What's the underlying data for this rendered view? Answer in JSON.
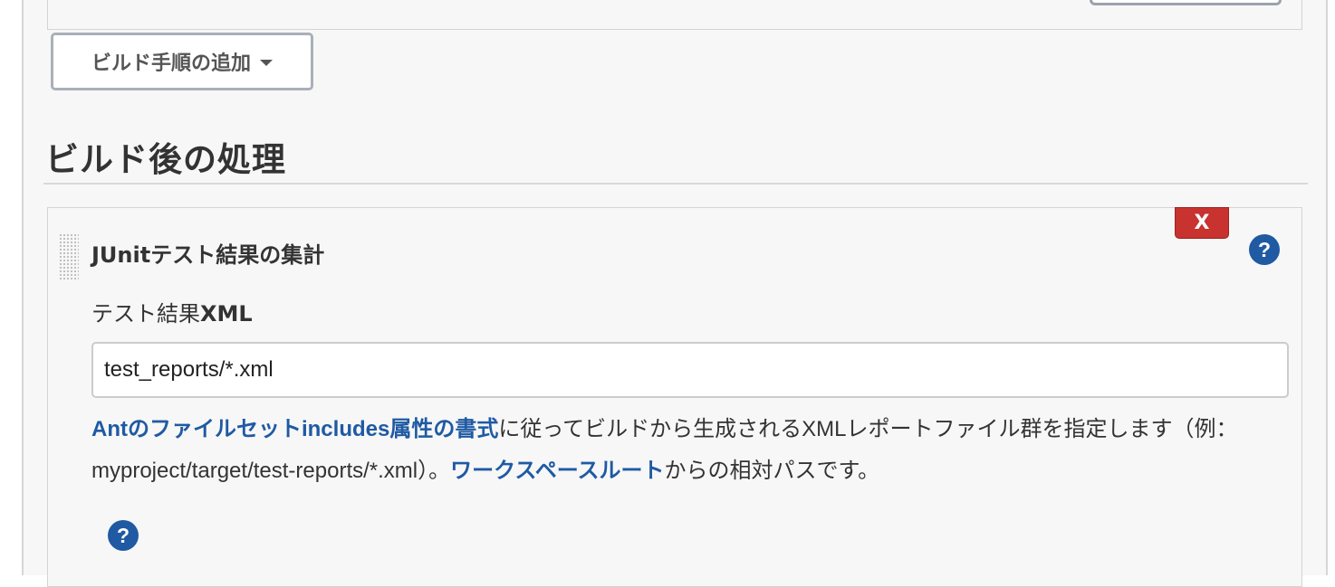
{
  "build_steps": {
    "add_step_label": "ビルド手順の追加"
  },
  "post_build": {
    "title": "ビルド後の処理",
    "publisher": {
      "title": "JUnitテスト結果の集計",
      "delete_label": "X",
      "help_label": "?",
      "field_label_prefix": "テスト結果",
      "field_label_bold": "XML",
      "input_value": "test_reports/*.xml",
      "description": {
        "link1": "Antのファイルセットincludes属性の書式",
        "text1": "に従ってビルドから生成されるXMLレポートファイル群を指定します（例：myproject/target/test-reports/*.xml）。",
        "link2": "ワークスペースルート",
        "text2": "からの相対パスです。"
      },
      "bottom_help_label": "?"
    }
  },
  "colors": {
    "link": "#1f5aa3",
    "delete": "#c8322f",
    "help": "#1f5aa3"
  },
  "icons": {
    "help": "question-circle-icon",
    "dropdown": "caret-down-icon",
    "drag": "drag-handle-icon"
  }
}
